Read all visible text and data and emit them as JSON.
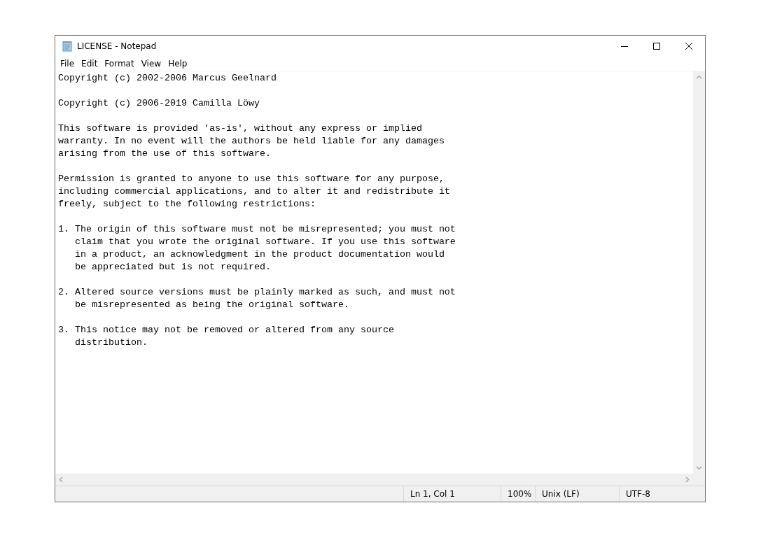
{
  "window": {
    "title": "LICENSE - Notepad"
  },
  "menu": [
    "File",
    "Edit",
    "Format",
    "View",
    "Help"
  ],
  "document": {
    "paragraphs": [
      [
        "Copyright (c) 2002-2006 Marcus Geelnard"
      ],
      [
        "Copyright (c) 2006-2019 Camilla Löwy"
      ],
      [
        "This software is provided 'as-is', without any express or implied",
        "warranty. In no event will the authors be held liable for any damages",
        "arising from the use of this software."
      ],
      [
        "Permission is granted to anyone to use this software for any purpose,",
        "including commercial applications, and to alter it and redistribute it",
        "freely, subject to the following restrictions:"
      ],
      [
        "1. The origin of this software must not be misrepresented; you must not",
        "   claim that you wrote the original software. If you use this software",
        "   in a product, an acknowledgment in the product documentation would",
        "   be appreciated but is not required."
      ],
      [
        "2. Altered source versions must be plainly marked as such, and must not",
        "   be misrepresented as being the original software."
      ],
      [
        "3. This notice may not be removed or altered from any source",
        "   distribution."
      ]
    ]
  },
  "status_bar": [
    "Ln 1, Col 1",
    "100%",
    "Unix (LF)",
    "UTF-8"
  ]
}
